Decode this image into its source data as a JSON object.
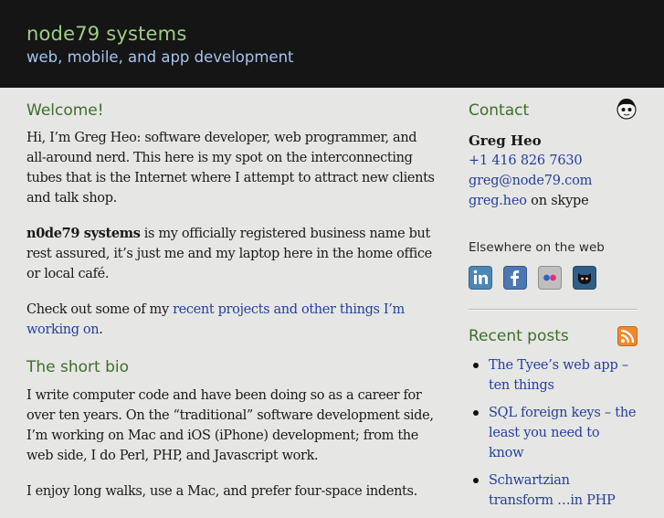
{
  "header": {
    "title": "node79 systems",
    "tagline": "web, mobile, and app development"
  },
  "main": {
    "welcome_heading": "Welcome!",
    "intro": "Hi, I’m Greg Heo: software developer, web programmer, and all-around nerd. This here is my spot on the interconnecting tubes that is the Internet where I attempt to attract new clients and talk shop.",
    "business_name": "n0de79 systems",
    "business_rest": " is my officially registered business name but rest assured, it’s just me and my laptop here in the home office or local café.",
    "checkout_prefix": "Check out some of my ",
    "checkout_link": "recent projects and other things I’m working on",
    "checkout_suffix": ".",
    "bio_heading": "The short bio",
    "bio_para": "I write computer code and have been doing so as a career for over ten years. On the “traditional” software development side, I’m working on Mac and iOS (iPhone) development; from the web side, I do Perl, PHP, and Javascript work.",
    "bio_para2": "I enjoy long walks, use a Mac, and prefer four-space indents."
  },
  "sidebar": {
    "contact_heading": "Contact",
    "avatar_icon": "avatar-icon",
    "name": "Greg Heo",
    "phone": "+1 416 826 7630",
    "email": "greg@node79.com",
    "skype_handle": "greg.heo",
    "skype_suffix": " on skype",
    "elsewhere_heading": "Elsewhere on the web",
    "social": [
      {
        "icon": "linkedin-icon",
        "color": "#4b87b6"
      },
      {
        "icon": "facebook-icon",
        "color": "#4d76b3"
      },
      {
        "icon": "flickr-icon",
        "color": "#bfbfbf"
      },
      {
        "icon": "github-icon",
        "color": "#2f5f86"
      }
    ],
    "recent_heading": "Recent posts",
    "rss_icon": "rss-icon",
    "posts": [
      "The Tyee’s web app – ten things",
      "SQL foreign keys – the least you need to know",
      "Schwartzian transform …in PHP"
    ]
  }
}
